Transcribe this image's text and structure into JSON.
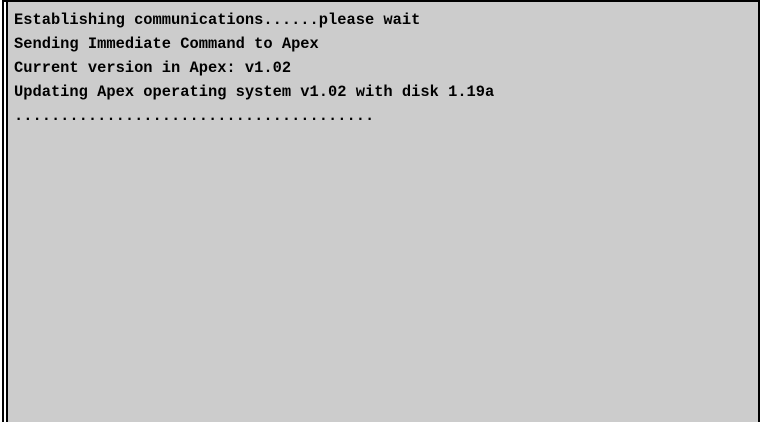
{
  "console": {
    "lines": [
      "Establishing communications......please wait",
      "Sending Immediate Command to Apex",
      "Current version in Apex: v1.02",
      "Updating Apex operating system v1.02 with disk 1.19a",
      "......................................."
    ]
  },
  "colors": {
    "background": "#cccccc",
    "text": "#000000",
    "frame": "#000000"
  }
}
